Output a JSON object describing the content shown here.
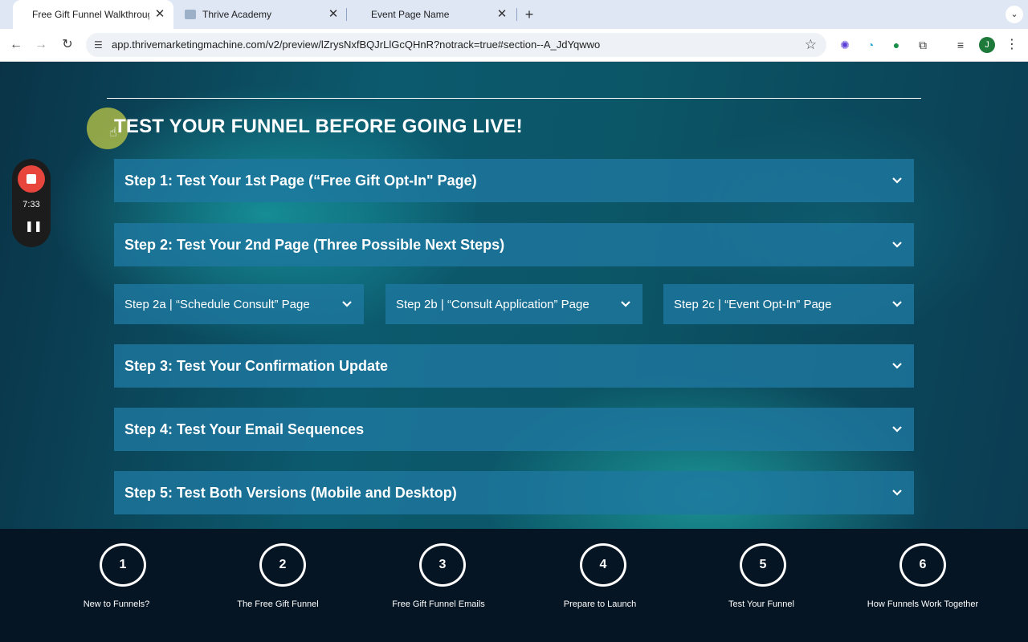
{
  "browser": {
    "tabs": [
      {
        "label": "Free Gift Funnel Walkthrough",
        "active": true
      },
      {
        "label": "Thrive Academy",
        "active": false
      },
      {
        "label": "Event Page Name",
        "active": false
      }
    ],
    "new_tab_label": "+",
    "url": "app.thrivemarketingmachine.com/v2/preview/lZrysNxfBQJrLlGcQHnR?notrack=true#section--A_JdYqwwo",
    "profile_initial": "J"
  },
  "recorder": {
    "time": "7:33"
  },
  "page": {
    "heading": "TEST YOUR FUNNEL BEFORE GOING LIVE!",
    "steps": [
      {
        "label": "Step 1: Test Your 1st Page (“Free Gift Opt-In\" Page)"
      },
      {
        "label": "Step 2: Test Your 2nd Page (Three Possible Next Steps)"
      },
      {
        "label": "Step 3: Test Your Confirmation Update"
      },
      {
        "label": "Step 4: Test Your Email Sequences"
      },
      {
        "label": "Step 5: Test Both Versions (Mobile and Desktop)"
      }
    ],
    "substeps": [
      {
        "label": "Step 2a | “Schedule Consult” Page"
      },
      {
        "label": "Step 2b | “Consult Application” Page"
      },
      {
        "label": "Step 2c | “Event Opt-In” Page"
      }
    ]
  },
  "bottom_nav": [
    {
      "number": "1",
      "caption": "New to Funnels?"
    },
    {
      "number": "2",
      "caption": "The Free Gift Funnel"
    },
    {
      "number": "3",
      "caption": "Free Gift Funnel Emails"
    },
    {
      "number": "4",
      "caption": "Prepare to Launch"
    },
    {
      "number": "5",
      "caption": "Test Your Funnel"
    },
    {
      "number": "6",
      "caption": "How Funnels Work Together"
    }
  ],
  "colors": {
    "accent": "#1e78a0",
    "recorder_stop": "#e8453c",
    "bottom_bar": "#061524"
  }
}
